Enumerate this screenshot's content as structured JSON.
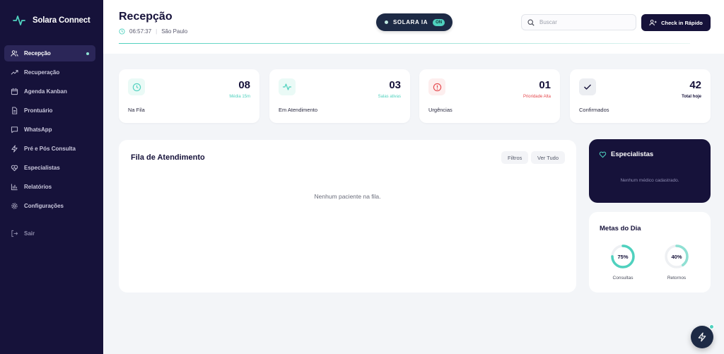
{
  "brand": {
    "name": "Solara Connect",
    "logo_icon": "pulse-icon"
  },
  "sidebar": {
    "items": [
      {
        "label": "Recepção",
        "icon": "users-icon",
        "active": true
      },
      {
        "label": "Recuperação",
        "icon": "trending-up-icon"
      },
      {
        "label": "Agenda Kanban",
        "icon": "calendar-icon"
      },
      {
        "label": "Prontuário",
        "icon": "file-icon"
      },
      {
        "label": "WhatsApp",
        "icon": "chat-icon"
      },
      {
        "label": "Pré e Pós Consulta",
        "icon": "zap-icon"
      },
      {
        "label": "Especialistas",
        "icon": "heart-pulse-icon"
      },
      {
        "label": "Relatórios",
        "icon": "bar-chart-icon"
      },
      {
        "label": "Configurações",
        "icon": "gear-icon"
      }
    ],
    "logout_label": "Sair"
  },
  "header": {
    "title": "Recepção",
    "time": "06:57:37",
    "city": "São Paulo",
    "ia_label": "SOLARA IA",
    "ia_status": "ON",
    "search_placeholder": "Buscar",
    "checkin_label": "Check in Rápido"
  },
  "stats": [
    {
      "value": "08",
      "sub": "Média 15m",
      "label": "Na Fila",
      "icon": "clock-icon",
      "color": "#4fd1be"
    },
    {
      "value": "03",
      "sub": "Salas ativas",
      "label": "Em Atendimento",
      "icon": "activity-icon",
      "color": "#4fd1be"
    },
    {
      "value": "01",
      "sub": "Prioridade Alta",
      "label": "Urgências",
      "icon": "alert-icon",
      "color": "#e5484d"
    },
    {
      "value": "42",
      "sub": "Total hoje",
      "label": "Confirmados",
      "icon": "check-icon",
      "color": "#16123a"
    }
  ],
  "queue": {
    "title": "Fila de Atendimento",
    "filter_label": "Filtros",
    "view_all_label": "Ver Tudo",
    "empty_text": "Nenhum paciente na fila."
  },
  "specialists": {
    "title": "Especialistas",
    "empty_text": "Nenhum médico cadastrado."
  },
  "goals": {
    "title": "Metas do Dia",
    "items": [
      {
        "label": "Consultas",
        "display": "75%",
        "progress": 0.75
      },
      {
        "label": "Retornos",
        "display": "40%",
        "progress": 0.4
      }
    ]
  },
  "colors": {
    "navy": "#16123a",
    "teal": "#4fd1be",
    "danger": "#e5484d"
  }
}
